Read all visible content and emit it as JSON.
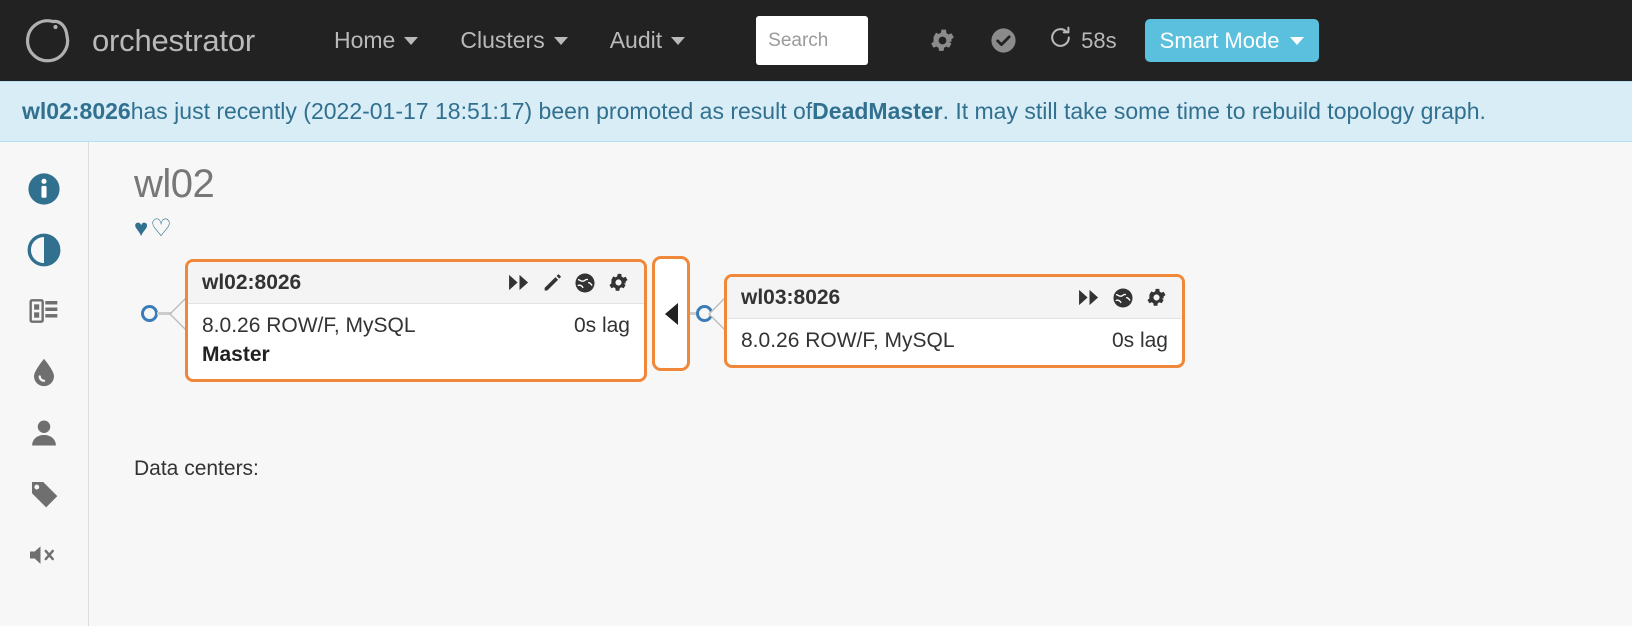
{
  "navbar": {
    "brand": "orchestrator",
    "logo_icon": "orchestrator-ring-logo",
    "links": [
      {
        "label": "Home",
        "icon": "chevron-down-icon"
      },
      {
        "label": "Clusters",
        "icon": "chevron-down-icon"
      },
      {
        "label": "Audit",
        "icon": "chevron-down-icon"
      }
    ],
    "search": {
      "value": "",
      "placeholder": "Search"
    },
    "icons": [
      {
        "name": "gear-icon"
      },
      {
        "name": "check-circle-icon"
      }
    ],
    "refresh": {
      "icon": "refresh-icon",
      "label": "58s"
    },
    "smart_mode": {
      "label": "Smart Mode",
      "icon": "chevron-down-icon",
      "color": "#5bc0de"
    }
  },
  "alert": {
    "instance": "wl02:8026",
    "text_1": " has just recently (2022-01-17 18:51:17) been promoted as result of ",
    "reason": "DeadMaster",
    "text_2": ". It may still take some time to rebuild topology graph.",
    "bg_color": "#d9edf7",
    "text_color": "#31708f"
  },
  "sidebar": {
    "items": [
      {
        "name": "info-icon",
        "active": true
      },
      {
        "name": "contrast-icon",
        "active": true
      },
      {
        "name": "server-rack-icon",
        "active": false
      },
      {
        "name": "droplet-icon",
        "active": false
      },
      {
        "name": "user-icon",
        "active": false
      },
      {
        "name": "tag-icon",
        "active": false
      },
      {
        "name": "volume-mute-icon",
        "active": false
      }
    ]
  },
  "cluster": {
    "title": "wl02",
    "hearts": {
      "filled": "♥",
      "outline": "♡"
    },
    "data_centers_label": "Data centers:"
  },
  "topology": {
    "accent_color": "#f0883a",
    "nodes": [
      {
        "id": "master",
        "title": "wl02:8026",
        "version": "8.0.26 ROW/F, MySQL",
        "lag": "0s lag",
        "role": "Master",
        "actions": [
          "fast-forward-icon",
          "pencil-icon",
          "globe-icon",
          "gear-icon"
        ]
      },
      {
        "id": "replica",
        "title": "wl03:8026",
        "version": "8.0.26 ROW/F, MySQL",
        "lag": "0s lag",
        "role": "",
        "actions": [
          "fast-forward-icon",
          "globe-icon",
          "gear-icon"
        ]
      }
    ],
    "connector": {
      "icon": "chevron-left-icon"
    }
  }
}
